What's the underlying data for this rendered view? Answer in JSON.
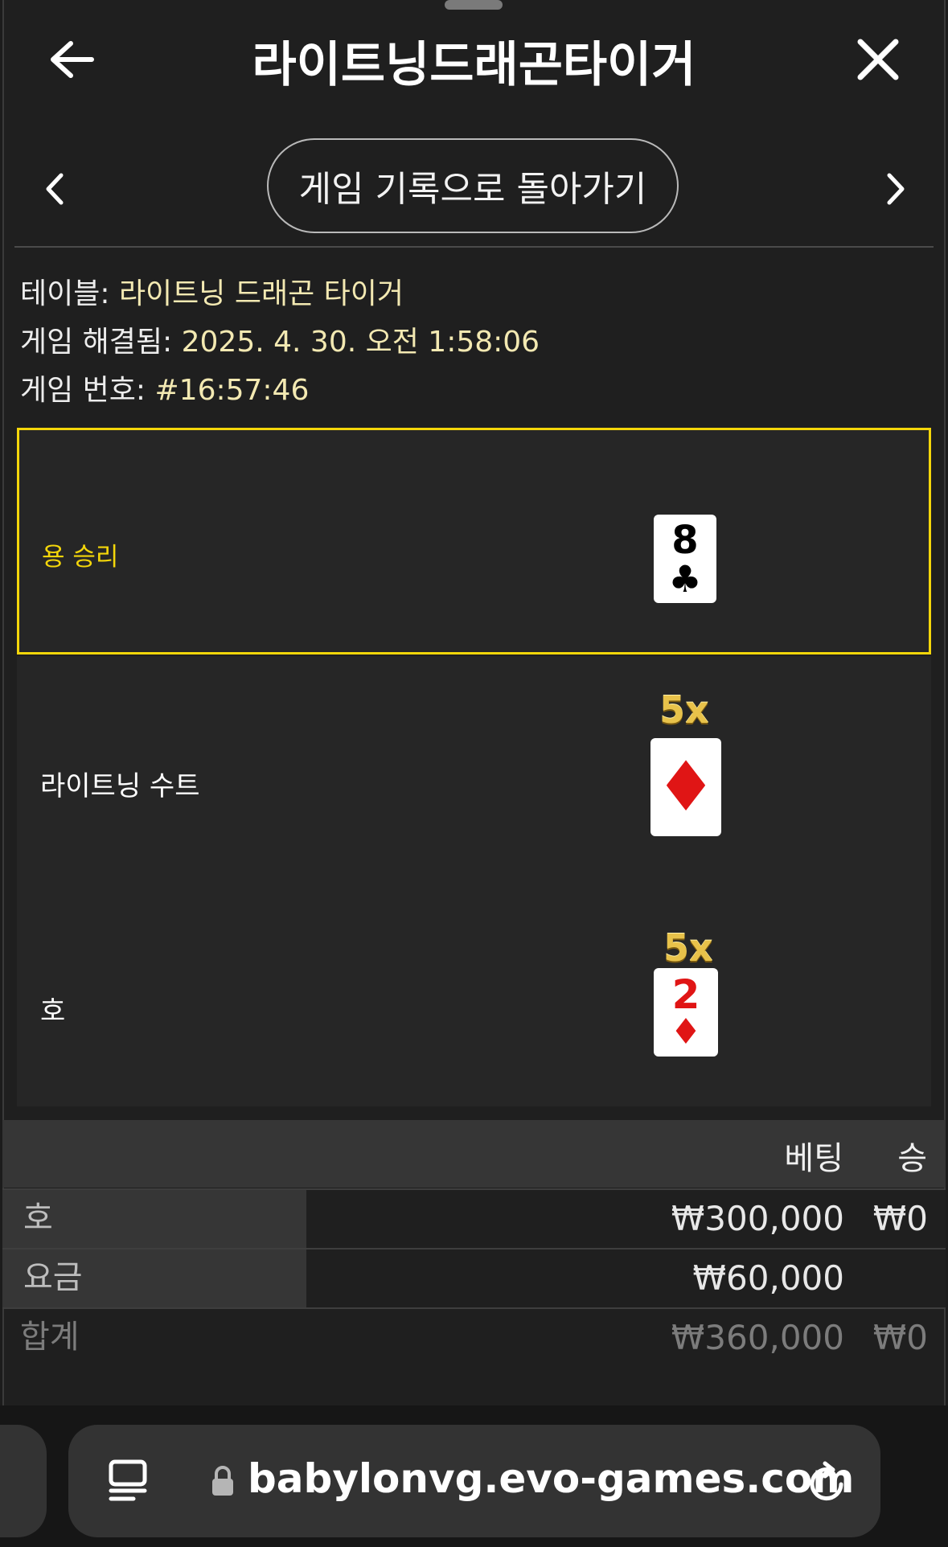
{
  "header": {
    "title": "라이트닝드래곤타이거",
    "back_link_label": "게임 기록으로 돌아가기"
  },
  "info": {
    "table_label": "테이블: ",
    "table_value": "라이트닝 드래곤 타이거",
    "resolved_label": "게임 해결됨: ",
    "resolved_value": "2025. 4. 30. 오전 1:58:06",
    "game_no_label": "게임 번호: ",
    "game_no_value": "#16:57:46"
  },
  "results": [
    {
      "label": "용 승리",
      "card_rank": "8",
      "card_suit": "♣",
      "suit_color": "#000000",
      "multiplier": ""
    },
    {
      "label": "라이트닝 수트",
      "card_rank": "",
      "card_suit": "♦",
      "suit_color": "#e01515",
      "multiplier": "5x"
    },
    {
      "label": "호",
      "card_rank": "2",
      "card_suit": "♦",
      "suit_color": "#e01515",
      "multiplier": "5x"
    }
  ],
  "bets": {
    "headers": {
      "bet": "베팅",
      "win": "승"
    },
    "rows": [
      {
        "label": "호",
        "bet": "₩300,000",
        "win": "₩0"
      },
      {
        "label": "요금",
        "bet": "₩60,000",
        "win": ""
      }
    ],
    "total": {
      "label": "합계",
      "bet": "₩360,000",
      "win": "₩0"
    }
  },
  "browser": {
    "url": "babylonvg.evo-games.com"
  },
  "colors": {
    "accent": "#f4d60a",
    "background": "#1f1f1f",
    "panel": "#262626"
  }
}
